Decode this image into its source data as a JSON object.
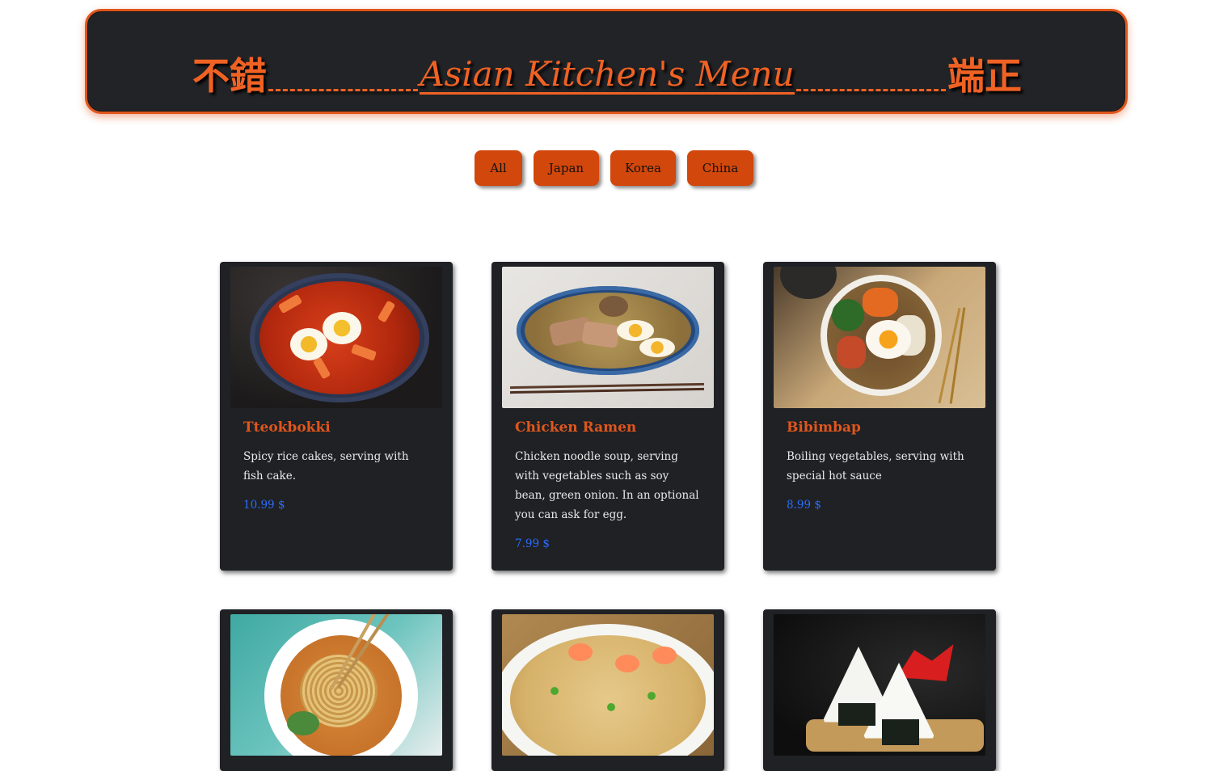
{
  "header": {
    "left_kanji": "不錯",
    "title": "Asian Kitchen's Menu",
    "right_kanji": "端正",
    "accent_color": "#f06224",
    "background_color": "#222326"
  },
  "filters": {
    "buttons": [
      {
        "label": "All"
      },
      {
        "label": "Japan"
      },
      {
        "label": "Korea"
      },
      {
        "label": "China"
      }
    ],
    "button_color": "#d2470c"
  },
  "menu": {
    "items": [
      {
        "title": "Tteokbokki",
        "description": "Spicy rice cakes, serving with fish cake.",
        "price": "10.99 $",
        "image_icon": "tteokbokki-bowl-icon"
      },
      {
        "title": "Chicken Ramen",
        "description": "Chicken noodle soup, serving with vegetables such as soy bean, green onion. In an optional you can ask for egg.",
        "price": "7.99 $",
        "image_icon": "ramen-bowl-icon"
      },
      {
        "title": "Bibimbap",
        "description": "Boiling vegetables, serving with special hot sauce",
        "price": "8.99 $",
        "image_icon": "bibimbap-bowl-icon"
      },
      {
        "image_icon": "dan-dan-noodles-icon"
      },
      {
        "image_icon": "fried-rice-plate-icon"
      },
      {
        "image_icon": "onigiri-icon"
      }
    ],
    "card_color": "#1f2125",
    "title_color": "#e0561c",
    "price_color": "#2b6cff"
  }
}
